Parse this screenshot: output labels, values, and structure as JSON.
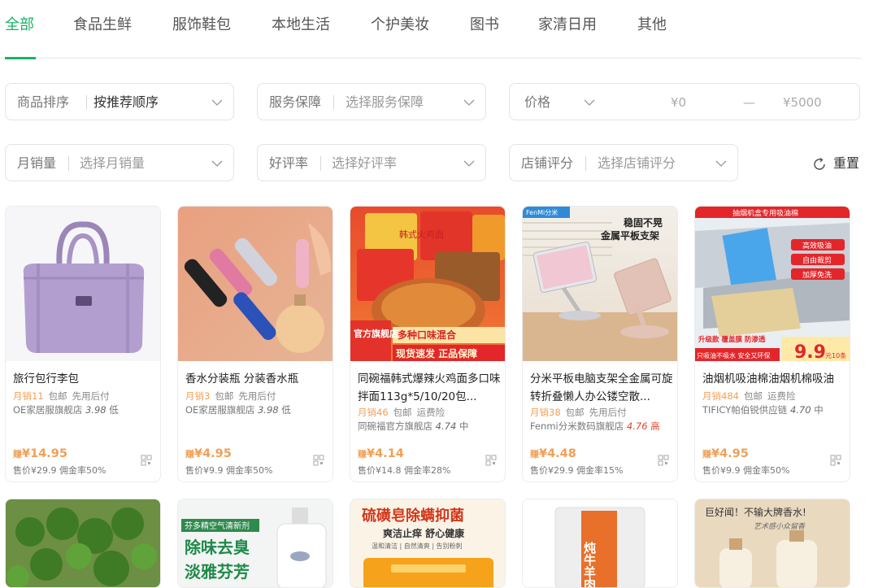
{
  "tabs": [
    {
      "label": "全部"
    },
    {
      "label": "食品生鲜"
    },
    {
      "label": "服饰鞋包"
    },
    {
      "label": "本地生活"
    },
    {
      "label": "个护美妆"
    },
    {
      "label": "图书"
    },
    {
      "label": "家清日用"
    },
    {
      "label": "其他"
    }
  ],
  "active_tab": "全部",
  "accent_color": "#18b367",
  "filters": {
    "sort": {
      "label": "商品排序",
      "value": "按推荐顺序"
    },
    "service": {
      "label": "服务保障",
      "placeholder": "选择服务保障"
    },
    "price": {
      "label": "价格",
      "min_placeholder": "¥0",
      "dash": "—",
      "max_placeholder": "¥5000"
    },
    "monthly_sales": {
      "label": "月销量",
      "placeholder": "选择月销量"
    },
    "rating": {
      "label": "好评率",
      "placeholder": "选择好评率"
    },
    "shop_score": {
      "label": "店铺评分",
      "placeholder": "选择店铺评分"
    },
    "reset_label": "重置",
    "reset_icon": "refresh-icon"
  },
  "products": [
    {
      "title": "旅行包行李包",
      "sold": "月销11",
      "tags": [
        "包邮",
        "先用后付"
      ],
      "shop": "OE家居服旗舰店",
      "score": "3.98",
      "level": "低",
      "earn": "¥14.95",
      "earn_prefix": "赚",
      "price": "售价¥29.9",
      "commission": "佣金率50%"
    },
    {
      "title": "香水分装瓶 分装香水瓶",
      "sold": "月销3",
      "tags": [
        "包邮",
        "先用后付"
      ],
      "shop": "OE家居服旗舰店",
      "score": "3.98",
      "level": "低",
      "earn": "¥4.95",
      "earn_prefix": "赚",
      "price": "售价¥9.9",
      "commission": "佣金率50%"
    },
    {
      "title": "同碗福韩式爆辣火鸡面多口味拌面113g*5/10/20包...",
      "sold": "月销46",
      "tags": [
        "包邮",
        "运费险"
      ],
      "shop": "同碗福官方旗舰店",
      "score": "4.74",
      "level": "中",
      "earn": "¥4.14",
      "earn_prefix": "赚",
      "price": "售价¥14.8",
      "commission": "佣金率28%"
    },
    {
      "title": "分米平板电脑支架全金属可旋转折叠懒人办公镂空散...",
      "sold": "月销38",
      "tags": [
        "包邮",
        "先用后付"
      ],
      "shop": "Fenmi分米数码旗舰店",
      "score": "4.76",
      "level": "高",
      "earn": "¥4.48",
      "earn_prefix": "赚",
      "price": "售价¥29.9",
      "commission": "佣金率15%"
    },
    {
      "title": "油烟机吸油棉油烟机棉吸油",
      "sold": "月销484",
      "tags": [
        "包邮",
        "运费险"
      ],
      "shop": "TIFICY帕伯锐供应链",
      "score": "4.70",
      "level": "中",
      "earn": "¥4.95",
      "earn_prefix": "赚",
      "price": "售价¥9.9",
      "commission": "佣金率50%"
    }
  ],
  "image_texts": {
    "p3": {
      "a": "韩式火鸡面",
      "b": "多种口味混合",
      "c": "官方旗舰店",
      "d": "现货速发 正品保障"
    },
    "p4": {
      "badge": "FenMi分米",
      "a": "稳固不晃",
      "b": "金属平板支架"
    },
    "p5": {
      "banner": "抽烟机盒专用吸油棉",
      "a": "高效吸油",
      "b": "自由裁剪",
      "c": "加厚免洗",
      "d": "升级款 覆盖膜 防渗透",
      "e": "9.9",
      "f": "只吸油不吸水 安全又环保",
      "g": "元10条"
    },
    "row2": {
      "b": {
        "a": "芬多精空气清新剂",
        "b": "除味去臭",
        "c": "淡雅芬芳"
      },
      "c": {
        "a": "硫磺皂除螨抑菌",
        "b": "爽洁止痒 舒心健康",
        "c": "温和清洁 | 自然清爽 | 告别粉刺"
      },
      "d": {
        "a": "炖牛羊肉料"
      },
      "e": {
        "a": "巨好闻！不输大牌香水!",
        "b": "艺术感小众留香"
      }
    }
  }
}
